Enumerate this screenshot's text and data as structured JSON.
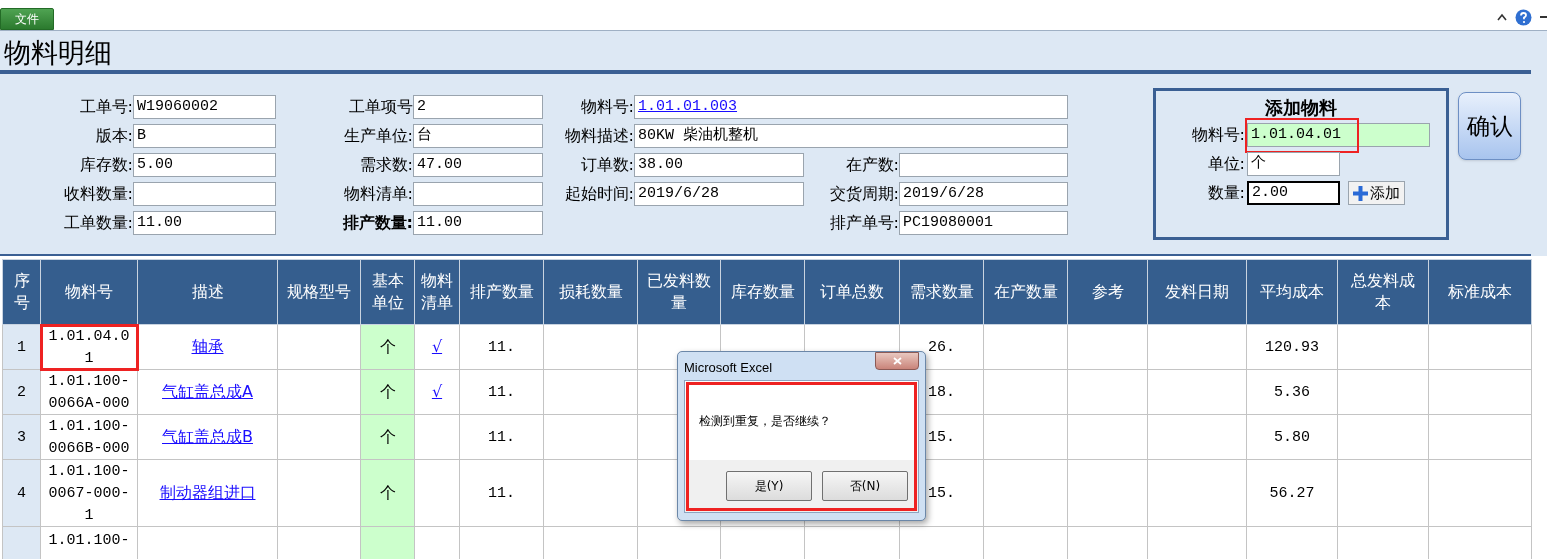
{
  "ribbon": {
    "file_tab": "文件"
  },
  "title": "物料明细",
  "form": {
    "column_1": [
      {
        "label": "工单号:",
        "value": "W19060002"
      },
      {
        "label": "版本:",
        "value": "B"
      },
      {
        "label": "库存数:",
        "value": "5.00"
      },
      {
        "label": "收料数量:"
      },
      {
        "label": "工单数量:",
        "value": "11.00"
      }
    ],
    "column_2": [
      {
        "label": "工单项号",
        "value": "2"
      },
      {
        "label": "生产单位:",
        "value": "台"
      },
      {
        "label": "需求数:",
        "value": "47.00"
      },
      {
        "label": "物料清单:"
      },
      {
        "label": "排产数量:",
        "value": "11.00",
        "bold": true
      }
    ],
    "column_3": [
      {
        "label": "物料号:",
        "value": "1.01.01.003",
        "link": true,
        "wide": true
      },
      {
        "label": "物料描述:",
        "value": "80KW 柴油机整机",
        "wide": true
      },
      {
        "label": "订单数:",
        "value": "38.00"
      },
      {
        "label": "起始时间:",
        "value": "2019/6/28"
      }
    ],
    "column_4": [
      {
        "label": "在产数:"
      },
      {
        "label": "交货周期:",
        "value": "2019/6/28"
      },
      {
        "label": "排产单号:",
        "value": "PC19080001"
      }
    ]
  },
  "add_panel": {
    "title": "添加物料",
    "fields": [
      {
        "label": "物料号:",
        "value": "1.01.04.01",
        "highlighted": true,
        "marked": true,
        "active": false
      },
      {
        "label": "单位:",
        "value": "个",
        "highlighted": false,
        "active": false
      },
      {
        "label": "数量:",
        "value": "2.00",
        "highlighted": false,
        "active": true
      }
    ],
    "add_button": "添加"
  },
  "confirm_button": "确认",
  "table": {
    "columns": [
      "序号",
      "物料号",
      "描述",
      "规格型号",
      "基本单位",
      "物料清单",
      "排产数量",
      "损耗数量",
      "已发料数量",
      "库存数量",
      "订单总数",
      "需求数量",
      "在产数量",
      "参考",
      "发料日期",
      "平均成本",
      "总发料成本",
      "标准成本"
    ],
    "rows": [
      {
        "index": "1",
        "material": "1.01.04.01",
        "marked": true,
        "description": "轴承",
        "unit": "个",
        "bom": "√",
        "planned_qty": "11.",
        "demand_qty": "26.",
        "average_cost": "120.93"
      },
      {
        "index": "2",
        "material": "1.01.100-0066A-000",
        "marked": false,
        "description": "气缸盖总成A",
        "unit": "个",
        "bom": "√",
        "planned_qty": "11.",
        "demand_qty": "18.",
        "average_cost": "5.36"
      },
      {
        "index": "3",
        "material": "1.01.100-0066B-000",
        "marked": false,
        "description": "气缸盖总成B",
        "unit": "个",
        "planned_qty": "11.",
        "demand_qty": "15.",
        "average_cost": "5.80"
      },
      {
        "index": "4",
        "material": "1.01.100-0067-000-1",
        "marked": false,
        "description": "制动器组进口",
        "unit": "个",
        "planned_qty": "11.",
        "demand_qty": "15.",
        "average_cost": "56.27"
      },
      {
        "material": "1.01.100-"
      }
    ]
  },
  "dialog": {
    "title": "Microsoft Excel",
    "message": "检测到重复，是否继续？",
    "buttons": [
      "是(Y)",
      "否(N)"
    ],
    "marked": true
  }
}
